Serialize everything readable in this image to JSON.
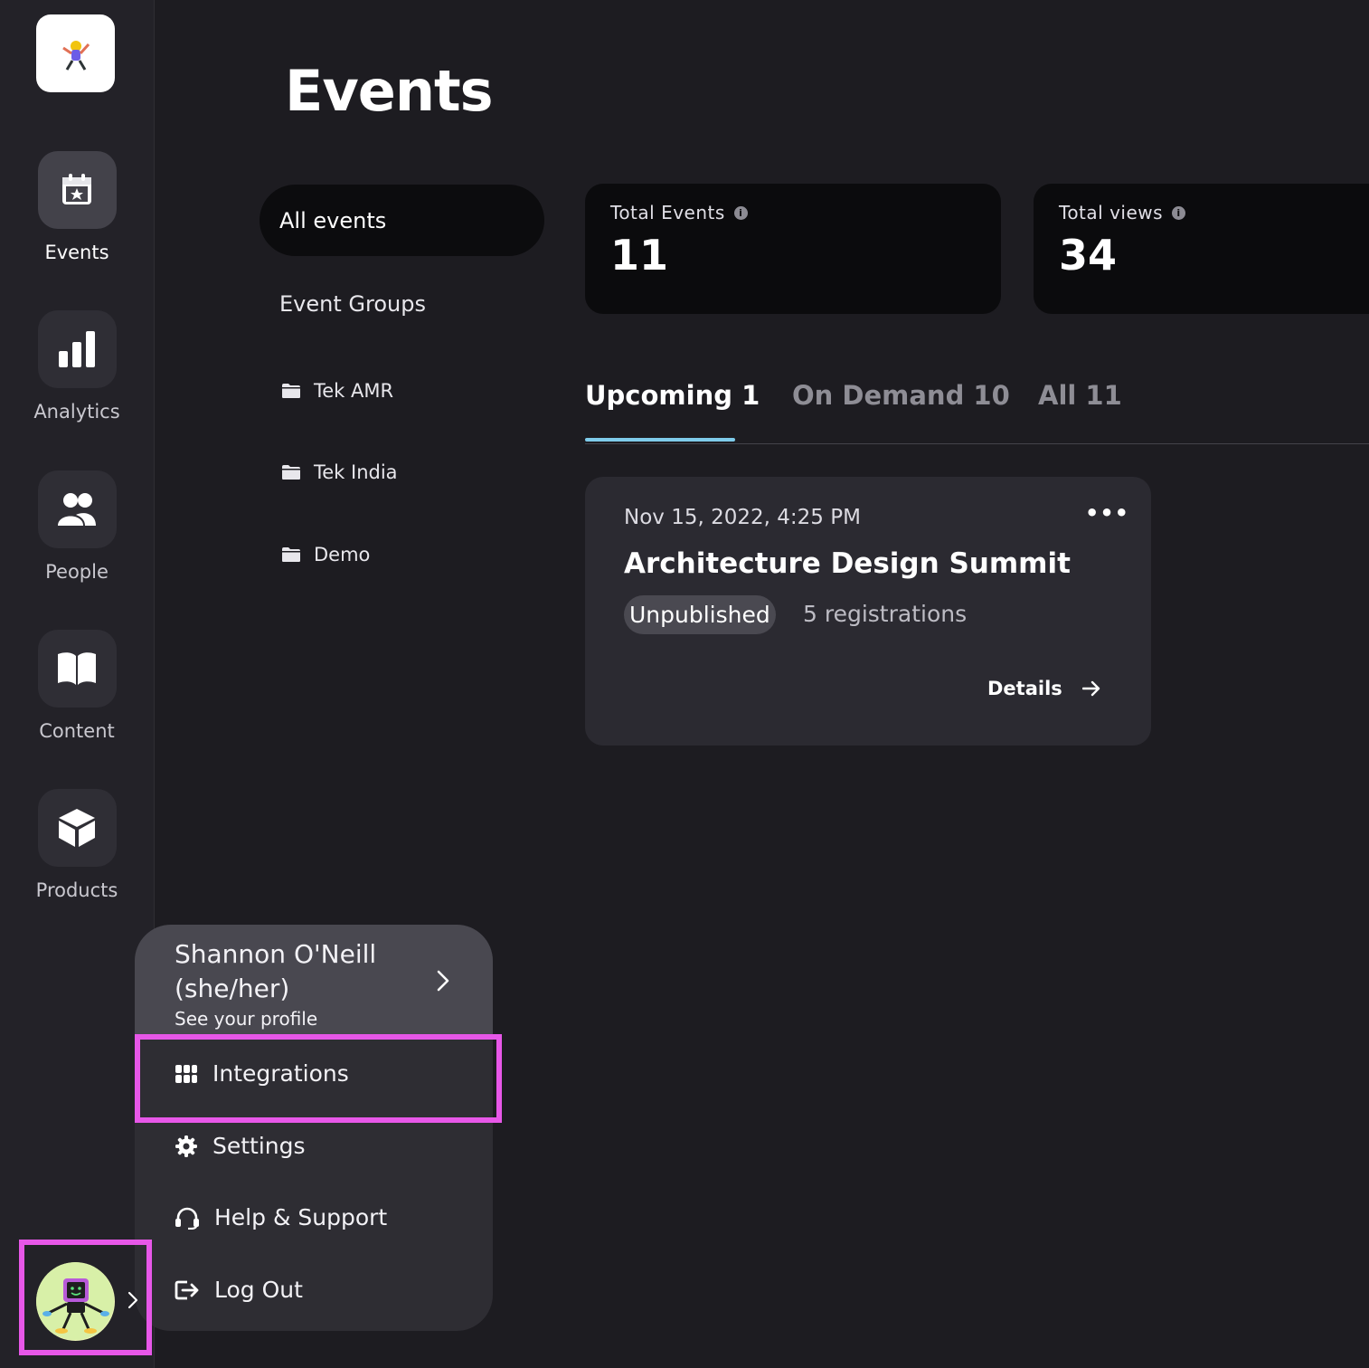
{
  "sidebar": {
    "items": [
      {
        "label": "Events",
        "icon": "calendar-star-icon"
      },
      {
        "label": "Analytics",
        "icon": "bar-chart-icon"
      },
      {
        "label": "People",
        "icon": "people-icon"
      },
      {
        "label": "Content",
        "icon": "book-icon"
      },
      {
        "label": "Products",
        "icon": "box-icon"
      }
    ]
  },
  "page": {
    "title": "Events"
  },
  "subnav": {
    "all_events": "All events",
    "event_groups": "Event Groups",
    "folders": [
      "Tek AMR",
      "Tek India",
      "Demo"
    ]
  },
  "stats": {
    "total_events_label": "Total Events",
    "total_events_value": "11",
    "total_views_label": "Total views",
    "total_views_value": "34"
  },
  "tabs": [
    {
      "label": "Upcoming 1",
      "active": true
    },
    {
      "label": "On Demand 10",
      "active": false
    },
    {
      "label": "All 11",
      "active": false
    }
  ],
  "event_card": {
    "date": "Nov 15, 2022, 4:25 PM",
    "title": "Architecture Design Summit",
    "status": "Unpublished",
    "registrations": "5 registrations",
    "details_label": "Details",
    "more_label": "•••"
  },
  "profile_menu": {
    "name": "Shannon O'Neill (she/her)",
    "subtitle": "See your profile",
    "items": [
      {
        "label": "Integrations",
        "icon": "grid-icon",
        "highlighted": true
      },
      {
        "label": "Settings",
        "icon": "gear-icon"
      },
      {
        "label": "Help & Support",
        "icon": "headset-icon"
      },
      {
        "label": "Log Out",
        "icon": "logout-icon"
      }
    ]
  },
  "colors": {
    "background": "#1d1c21",
    "sidebar": "#232228",
    "highlight": "#e757e8",
    "tab_underline": "#7ecbea"
  }
}
